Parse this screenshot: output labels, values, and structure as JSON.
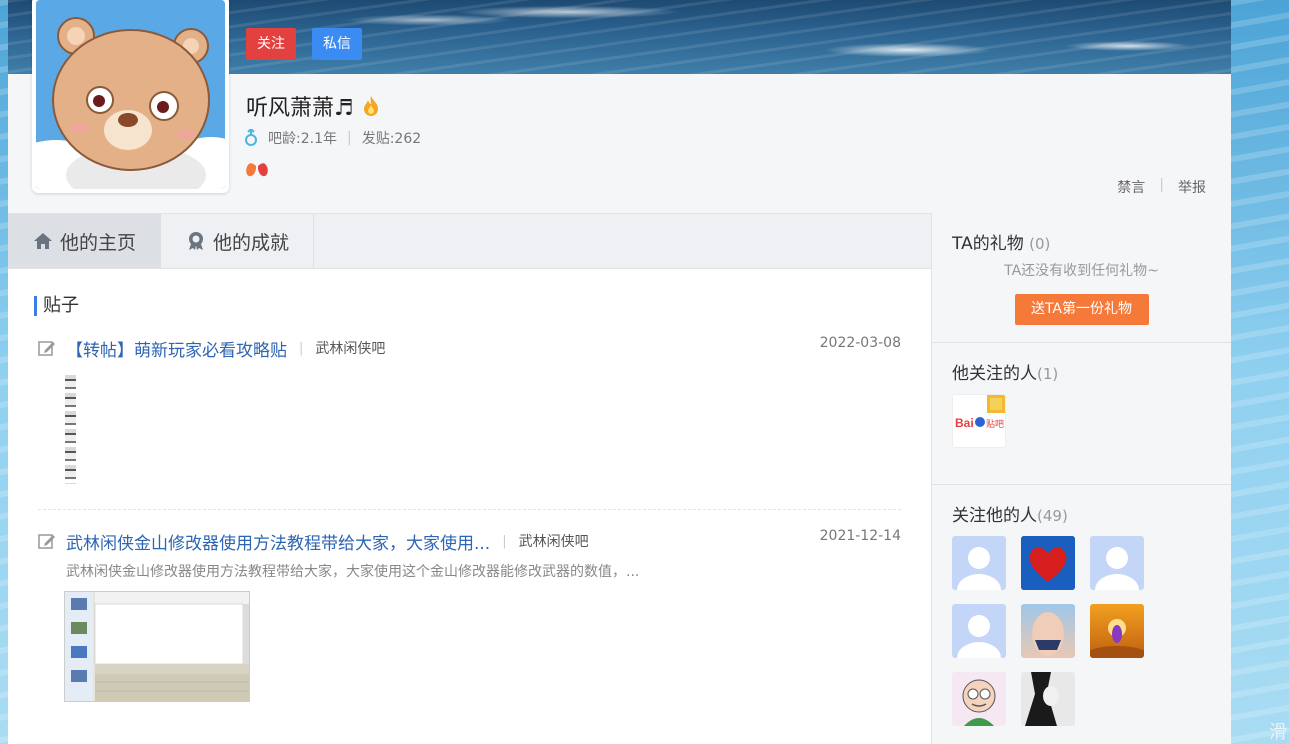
{
  "profile": {
    "follow_label": "关注",
    "message_label": "私信",
    "username": "听风萧萧♬",
    "age_label": "吧龄:2.1年",
    "posts_label": "发贴:262",
    "ban_label": "禁言",
    "report_label": "举报"
  },
  "tabs": [
    {
      "label": "他的主页",
      "icon": "home-icon"
    },
    {
      "label": "他的成就",
      "icon": "achievement-icon"
    }
  ],
  "posts_section": {
    "title": "贴子",
    "items": [
      {
        "title": "【转帖】萌新玩家必看攻略贴",
        "forum": "武林闲侠吧",
        "date": "2022-03-08",
        "summary": ""
      },
      {
        "title": "武林闲侠金山修改器使用方法教程带给大家，大家使用...",
        "forum": "武林闲侠吧",
        "date": "2021-12-14",
        "summary": "武林闲侠金山修改器使用方法教程带给大家，大家使用这个金山修改器能修改武器的数值，..."
      }
    ]
  },
  "gifts": {
    "title": "TA的礼物",
    "count": "(0)",
    "empty_text": "TA还没有收到任何礼物~",
    "button_label": "送TA第一份礼物"
  },
  "following": {
    "title": "他关注的人",
    "count": "(1)"
  },
  "followers": {
    "title": "关注他的人",
    "count": "(49)"
  },
  "corner_text": "滑",
  "colors": {
    "follow_button": "#e2413f",
    "message_button": "#3a8cf3",
    "gift_button": "#f57a3a",
    "link_blue": "#2d64b3"
  }
}
